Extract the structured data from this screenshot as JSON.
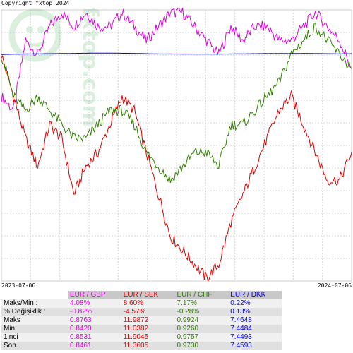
{
  "copyright": "Copyright fxtop 2024",
  "watermark": {
    "text": "fxtop.com"
  },
  "chart_data": {
    "type": "line",
    "x_start": "2023-07-06",
    "x_end": "2024-07-06",
    "grid": true,
    "series": [
      {
        "name": "EUR / GBP",
        "color": "#e000e0",
        "values": [
          97,
          96,
          101,
          100,
          102,
          103,
          102,
          103,
          102,
          102,
          103,
          102,
          101,
          102,
          103,
          103,
          102,
          101,
          100,
          102,
          101,
          102,
          102,
          101,
          101,
          102,
          103,
          102,
          101,
          99
        ]
      },
      {
        "name": "EUR / SEK",
        "color": "#e00000",
        "values": [
          100,
          97,
          94,
          92,
          95,
          94,
          90,
          92,
          93,
          95,
          97,
          96,
          93,
          90,
          87,
          86,
          85,
          84,
          85,
          88,
          90,
          92,
          94,
          96,
          97,
          95,
          93,
          91,
          91,
          93
        ]
      },
      {
        "name": "EUR / CHF",
        "color": "#308000",
        "values": [
          100,
          97,
          96,
          97,
          96,
          95,
          94,
          94,
          95,
          96,
          96,
          95,
          93,
          92,
          91,
          92,
          93,
          93,
          92,
          95,
          95,
          96,
          97,
          98,
          100,
          101,
          102,
          101,
          100,
          99
        ]
      },
      {
        "name": "EUR / DKK",
        "color": "#0000ff",
        "values": [
          100.0,
          100.02,
          100.04,
          100.05,
          100.06,
          100.07,
          100.08,
          100.09,
          100.1,
          100.1,
          100.09,
          100.08,
          100.06,
          100.04,
          100.04,
          100.03,
          100.03,
          100.03,
          100.03,
          100.04,
          100.05,
          100.06,
          100.07,
          100.07,
          100.07,
          100.08,
          100.07,
          100.06,
          100.05,
          100.06
        ]
      }
    ]
  },
  "table": {
    "headers": [
      "EUR / GBP",
      "EUR / SEK",
      "EUR / CHF",
      "EUR / DKK"
    ],
    "rows": [
      {
        "label": "Maks/Min :",
        "values": [
          "4.08%",
          "8.60%",
          "7.17%",
          "0.22%"
        ]
      },
      {
        "label": "% Değişiklik :",
        "values": [
          "-0.82%",
          "-4.57%",
          "-0.28%",
          "0.13%"
        ]
      },
      {
        "label": "Maks",
        "values": [
          "0.8763",
          "11.9872",
          "0.9924",
          "7.4648"
        ]
      },
      {
        "label": "Min",
        "values": [
          "0.8420",
          "11.0382",
          "0.9260",
          "7.4484"
        ]
      },
      {
        "label": "1inci",
        "values": [
          "0.8531",
          "11.9045",
          "0.9757",
          "7.4493"
        ]
      },
      {
        "label": "Son.",
        "values": [
          "0.8461",
          "11.3605",
          "0.9730",
          "7.4593"
        ]
      }
    ]
  }
}
